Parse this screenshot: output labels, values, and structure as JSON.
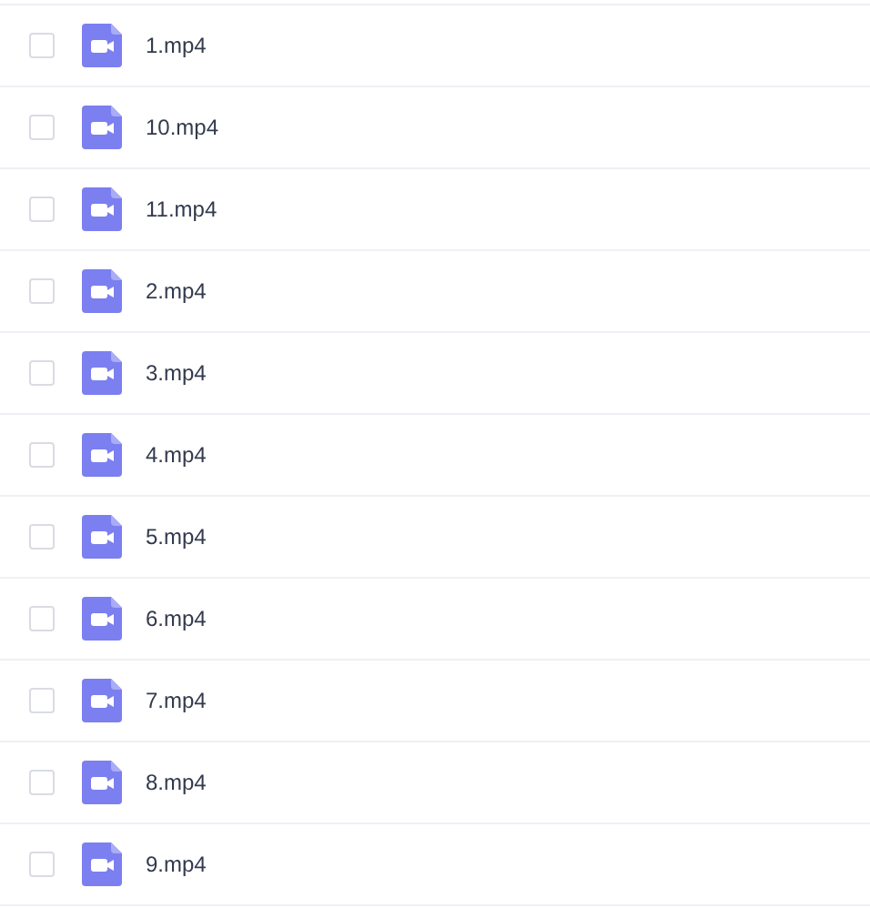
{
  "files": [
    {
      "name": "1.mp4",
      "checked": false
    },
    {
      "name": "10.mp4",
      "checked": false
    },
    {
      "name": "11.mp4",
      "checked": false
    },
    {
      "name": "2.mp4",
      "checked": false
    },
    {
      "name": "3.mp4",
      "checked": false
    },
    {
      "name": "4.mp4",
      "checked": false
    },
    {
      "name": "5.mp4",
      "checked": false
    },
    {
      "name": "6.mp4",
      "checked": false
    },
    {
      "name": "7.mp4",
      "checked": false
    },
    {
      "name": "8.mp4",
      "checked": false
    },
    {
      "name": "9.mp4",
      "checked": false
    }
  ]
}
